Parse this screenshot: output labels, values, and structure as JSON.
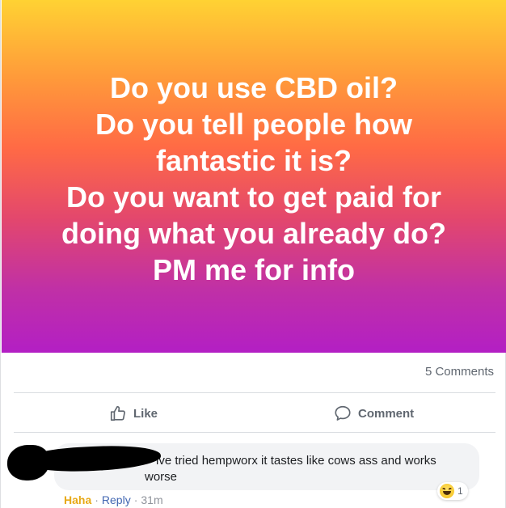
{
  "post": {
    "banner_lines": [
      "Do you use CBD oil?",
      "Do you tell people how",
      "fantastic it is?",
      "Do you want to get paid for",
      "doing what you already do?",
      "PM me for info"
    ],
    "comments_count": "5 Comments",
    "actions": {
      "like_label": "Like",
      "comment_label": "Comment"
    }
  },
  "comment": {
    "text_line1": "ive tried hempworx it tastes like cows ass and works",
    "text_line2": "worse",
    "reaction_count": "1",
    "reaction_icon": "haha-emoji-icon",
    "actions": {
      "haha_label": "Haha",
      "separator": "·",
      "reply_label": "Reply",
      "time": "31m"
    }
  },
  "colors": {
    "gradient_top": "#ffd233",
    "gradient_bottom": "#b31fc4",
    "haha_color": "#e7a917"
  }
}
